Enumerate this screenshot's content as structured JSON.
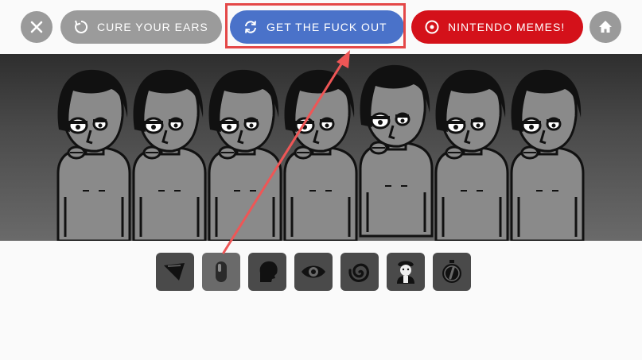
{
  "toolbar": {
    "close_icon": "close-icon",
    "cure_label": "CURE YOUR EARS",
    "cure_icon": "refresh-icon",
    "get_out_label": "GET THE FUCK OUT",
    "get_out_icon": "sync-icon",
    "nintendo_label": "NINTENDO MEMES!",
    "nintendo_icon": "record-icon",
    "home_icon": "home-icon"
  },
  "colors": {
    "gray_button": "#9b9b9b",
    "blue_button": "#4a72c9",
    "red_button": "#d4111a",
    "annotation": "#e44848"
  },
  "stage": {
    "character_count": 7
  },
  "sound_palette": [
    {
      "icon": "paper-icon",
      "active": false
    },
    {
      "icon": "capsule-icon",
      "active": true
    },
    {
      "icon": "head-icon",
      "active": false
    },
    {
      "icon": "eye-icon",
      "active": false
    },
    {
      "icon": "spiral-icon",
      "active": false
    },
    {
      "icon": "portrait-icon",
      "active": false
    },
    {
      "icon": "stopwatch-icon",
      "active": false
    }
  ]
}
